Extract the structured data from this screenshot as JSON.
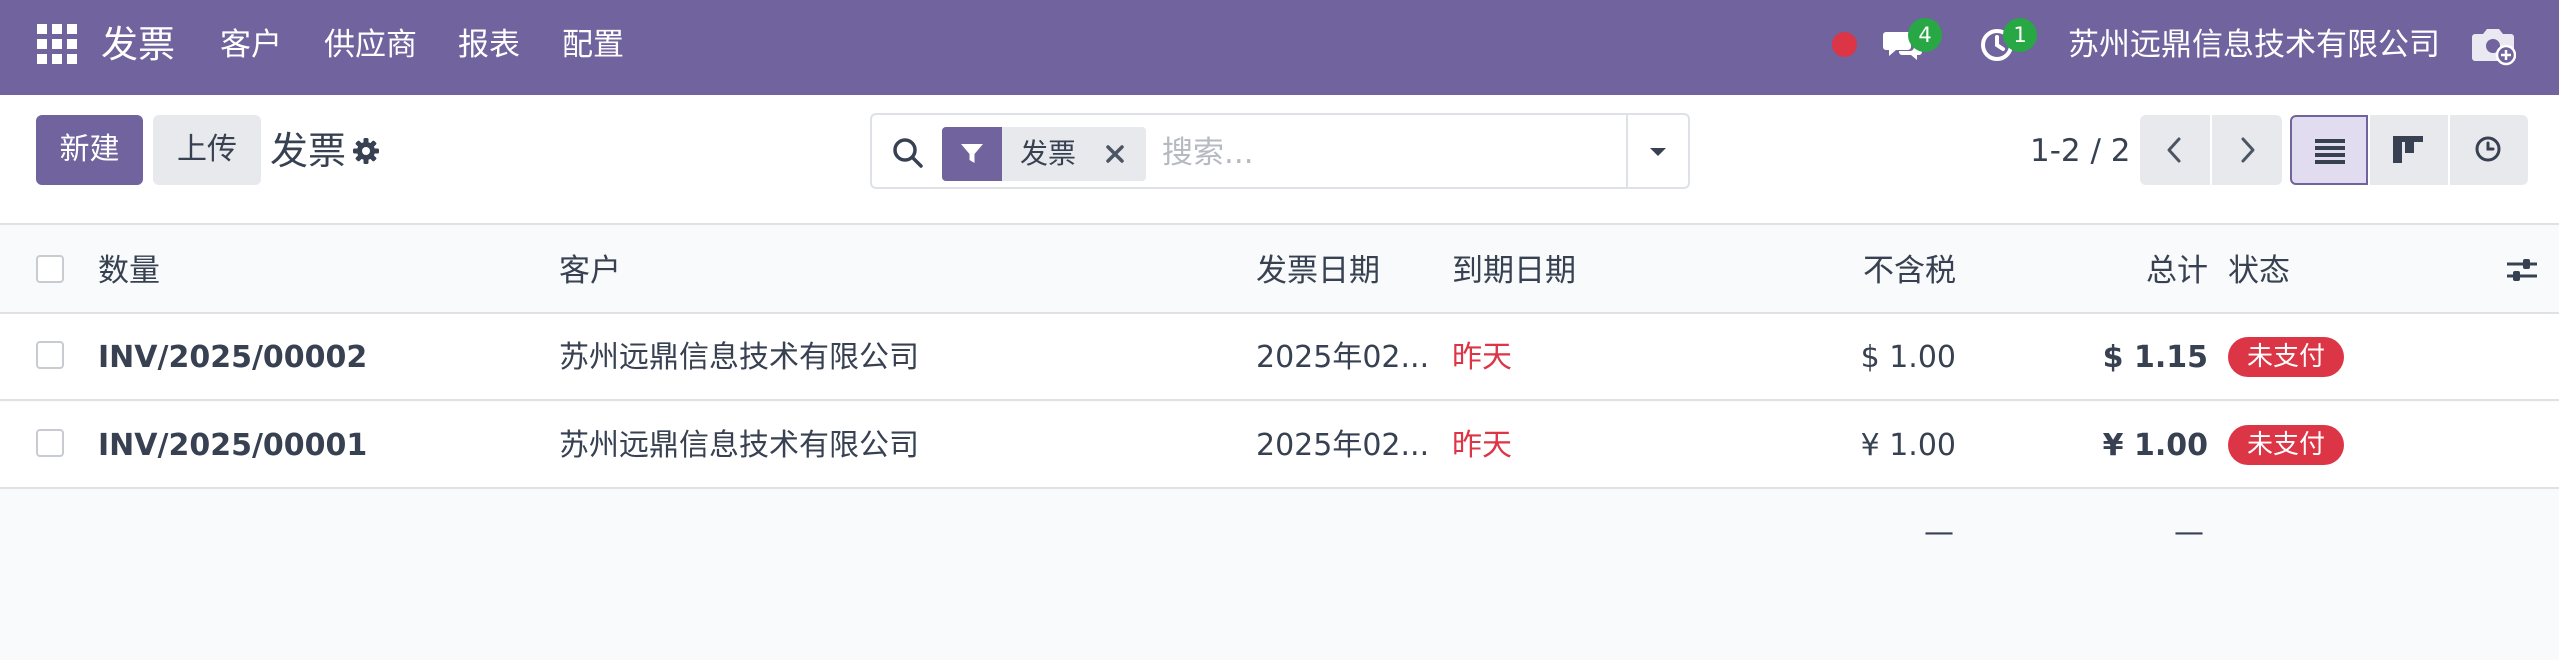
{
  "navbar": {
    "brand": "发票",
    "menu": [
      {
        "label": "客户"
      },
      {
        "label": "供应商"
      },
      {
        "label": "报表"
      },
      {
        "label": "配置"
      }
    ],
    "chat_count": "4",
    "activity_count": "1",
    "company": "苏州远鼎信息技术有限公司",
    "icons": [
      "apps-grid-icon",
      "record-dot",
      "chat-icon",
      "clock-icon",
      "camera-icon"
    ],
    "accent_color": "#71639e"
  },
  "control_panel": {
    "new_label": "新建",
    "upload_label": "上传",
    "title": "发票",
    "search": {
      "facet_label": "发票",
      "placeholder": "搜索..."
    },
    "pager": "1-2 / 2"
  },
  "table": {
    "columns": [
      "数量",
      "客户",
      "发票日期",
      "到期日期",
      "不含税",
      "总计",
      "状态"
    ],
    "rows": [
      {
        "number": "INV/2025/00002",
        "customer": "苏州远鼎信息技术有限公司",
        "invoice_date": "2025年02...",
        "due_date": "昨天",
        "untaxed": "$ 1.00",
        "total": "$ 1.15",
        "status": "未支付"
      },
      {
        "number": "INV/2025/00001",
        "customer": "苏州远鼎信息技术有限公司",
        "invoice_date": "2025年02...",
        "due_date": "昨天",
        "untaxed": "¥ 1.00",
        "total": "¥ 1.00",
        "status": "未支付"
      }
    ],
    "footer": {
      "untaxed_sum": "—",
      "total_sum": "—"
    }
  },
  "colors": {
    "danger": "#dc3545",
    "success_badge": "#28a745"
  }
}
